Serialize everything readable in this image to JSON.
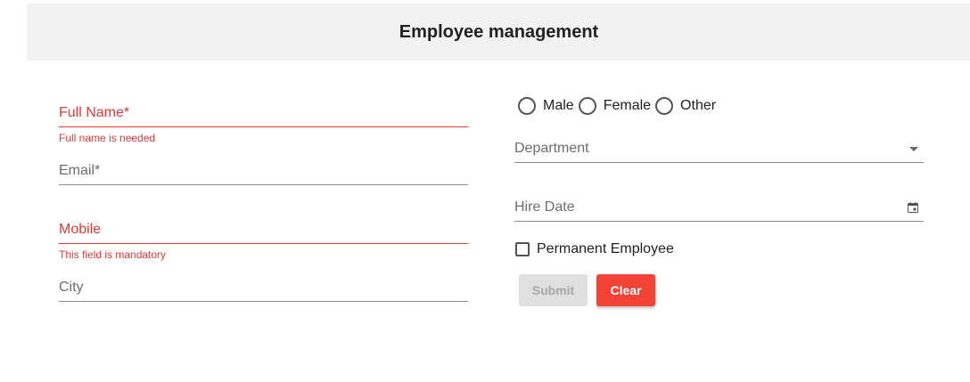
{
  "header": {
    "title": "Employee management"
  },
  "form": {
    "full_name": {
      "label": "Full Name*",
      "error": "Full name is needed"
    },
    "email": {
      "label": "Email*"
    },
    "mobile": {
      "label": "Mobile",
      "error": "This field is mandatory"
    },
    "city": {
      "label": "City"
    },
    "gender": {
      "options": [
        "Male",
        "Female",
        "Other"
      ],
      "selected": ""
    },
    "department": {
      "label": "Department"
    },
    "hire_date": {
      "label": "Hire Date"
    },
    "permanent": {
      "label": "Permanent Employee",
      "checked": false
    },
    "submit_label": "Submit",
    "clear_label": "Clear"
  },
  "colors": {
    "error": "#e53935",
    "clear_button": "#f44336",
    "header_bg": "#f2f2f2"
  },
  "icons": {
    "department_dropdown": "caret-down-icon",
    "hire_date_picker": "calendar-icon"
  }
}
